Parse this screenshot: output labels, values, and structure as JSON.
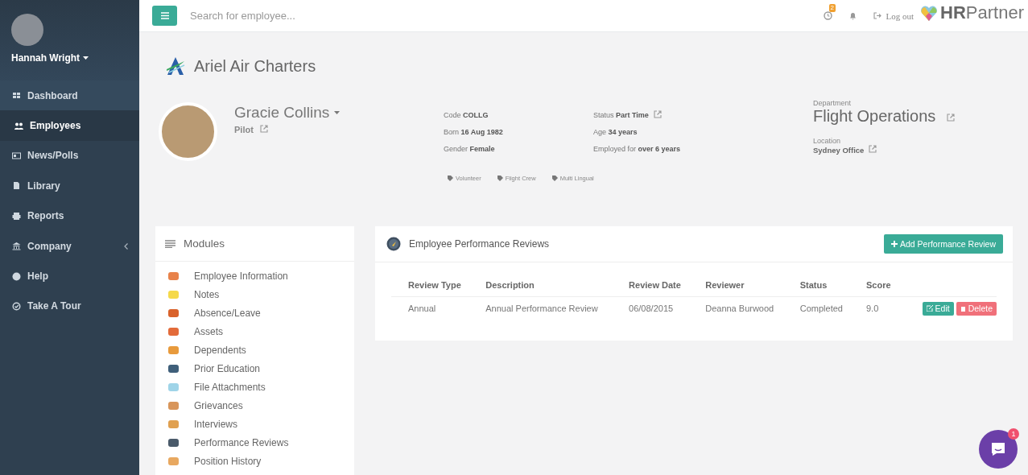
{
  "sidebar": {
    "user": {
      "name": "Hannah Wright"
    },
    "items": [
      {
        "label": "Dashboard",
        "selected": false,
        "kind": "link"
      },
      {
        "label": "Employees",
        "selected": true,
        "kind": "link"
      },
      {
        "label": "News/Polls",
        "selected": false,
        "kind": "link"
      },
      {
        "label": "Library",
        "selected": false,
        "kind": "link"
      },
      {
        "label": "Reports",
        "selected": false,
        "kind": "link"
      },
      {
        "label": "Company",
        "selected": false,
        "kind": "submenu"
      },
      {
        "label": "Help",
        "selected": false,
        "kind": "link"
      },
      {
        "label": "Take A Tour",
        "selected": false,
        "kind": "link"
      }
    ]
  },
  "topbar": {
    "search": {
      "placeholder": "Search for employee..."
    },
    "timer_badge": "2",
    "logout": "Log out",
    "logo": "**HR**Partner"
  },
  "company": {
    "name": "Ariel Air Charters"
  },
  "employee": {
    "name": "Gracie Collins",
    "position": "Pilot",
    "details": [
      {
        "label": "Code",
        "value": "COLLG",
        "link": false
      },
      {
        "label": "Status",
        "value": "Part Time",
        "link": true
      },
      {
        "label": "Born",
        "value": "16 Aug 1982",
        "link": false
      },
      {
        "label": "Age",
        "value": "34 years",
        "link": false
      },
      {
        "label": "Gender",
        "value": "Female",
        "link": false
      },
      {
        "label": "Employed for",
        "value": "over 6 years",
        "link": false
      }
    ],
    "tags": [
      "Volunteer",
      "Flight Crew",
      "Multi Lingual"
    ],
    "department_label": "Department",
    "department": "Flight Operations",
    "location_label": "Location",
    "location": "Sydney Office"
  },
  "modules": {
    "title": "Modules",
    "items": [
      {
        "label": "Employee Information",
        "color": "#e8824a"
      },
      {
        "label": "Notes",
        "color": "#f5d94a"
      },
      {
        "label": "Absence/Leave",
        "color": "#d9622b"
      },
      {
        "label": "Assets",
        "color": "#e36b3a"
      },
      {
        "label": "Dependents",
        "color": "#e89a3c"
      },
      {
        "label": "Prior Education",
        "color": "#3f5f7a"
      },
      {
        "label": "File Attachments",
        "color": "#9fd4e8"
      },
      {
        "label": "Grievances",
        "color": "#d8955a"
      },
      {
        "label": "Interviews",
        "color": "#e0a050"
      },
      {
        "label": "Performance Reviews",
        "color": "#4a5a6a"
      },
      {
        "label": "Position History",
        "color": "#e8a860"
      }
    ]
  },
  "reviews": {
    "title": "Employee Performance Reviews",
    "add_button": "Add Performance Review",
    "columns": [
      "Review Type",
      "Description",
      "Review Date",
      "Reviewer",
      "Status",
      "Score"
    ],
    "rows": [
      {
        "cells": [
          "Annual",
          "Annual Performance Review",
          "06/08/2015",
          "Deanna Burwood",
          "Completed",
          "9.0"
        ],
        "actions": [
          "Edit",
          "Delete"
        ]
      }
    ]
  },
  "chat": {
    "badge": "1"
  }
}
